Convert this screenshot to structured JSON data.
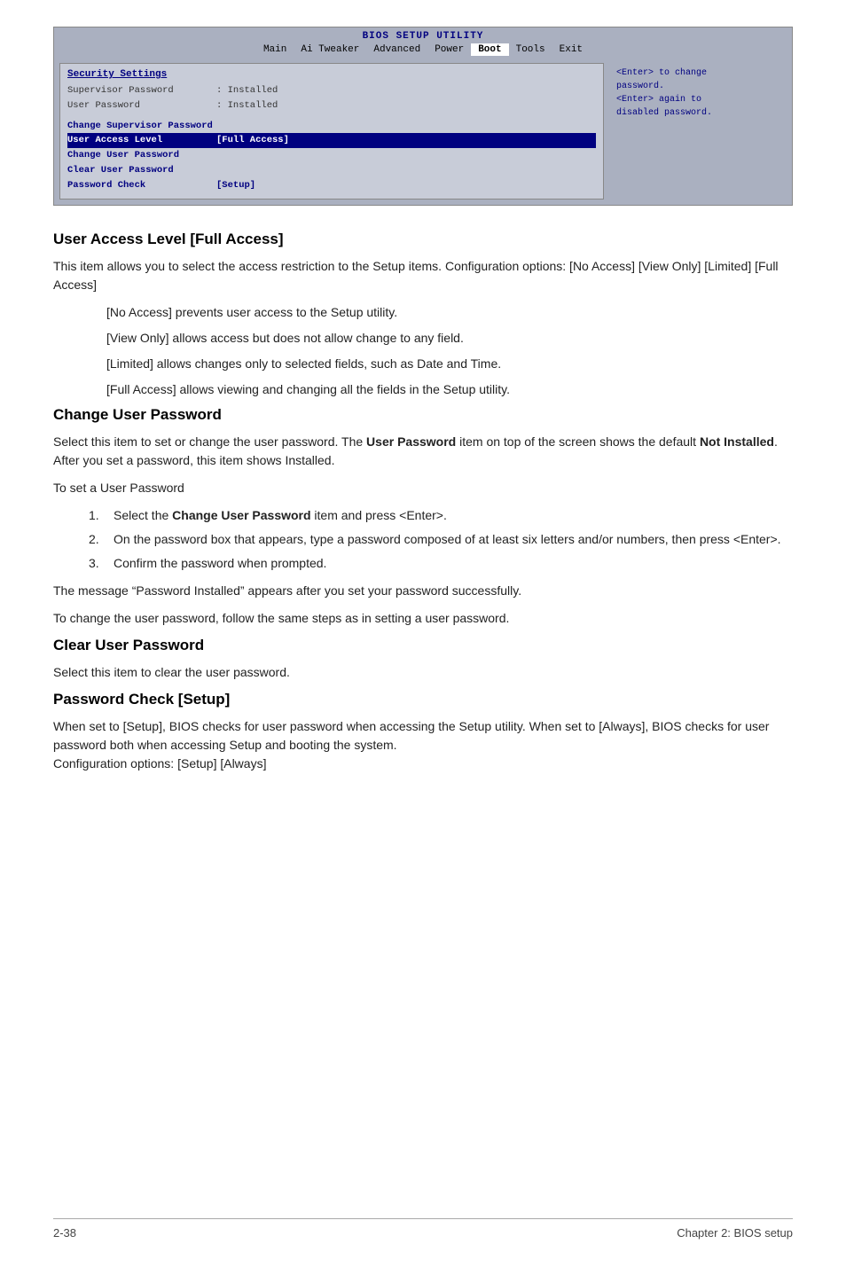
{
  "bios": {
    "title": "BIOS SETUP UTILITY",
    "tabs": [
      "Main",
      "Ai Tweaker",
      "Advanced",
      "Power",
      "Boot",
      "Tools",
      "Exit"
    ],
    "active_tab": "Boot",
    "left_panel": {
      "section_title": "Security Settings",
      "items": [
        {
          "label": "Supervisor Password",
          "value": ": Installed",
          "style": "dim"
        },
        {
          "label": "User Password",
          "value": ": Installed",
          "style": "dim"
        },
        {
          "label": "",
          "value": "",
          "style": "separator"
        },
        {
          "label": "Change Supervisor Password",
          "value": "",
          "style": "highlight"
        },
        {
          "label": "User Access Level",
          "value": "[Full Access]",
          "style": "highlight"
        },
        {
          "label": "Change User Password",
          "value": "",
          "style": "highlight"
        },
        {
          "label": "Clear User Password",
          "value": "",
          "style": "highlight"
        },
        {
          "label": "Password Check",
          "value": "[Setup]",
          "style": "highlight"
        }
      ]
    },
    "right_panel": {
      "text": "<Enter> to change password.\n<Enter> again to disabled password."
    }
  },
  "sections": [
    {
      "id": "user-access-level",
      "heading": "User Access Level [Full Access]",
      "paragraphs": [
        "This item allows you to select the access restriction to the Setup items. Configuration options: [No Access] [View Only] [Limited] [Full Access]"
      ],
      "indented": [
        "[No Access] prevents user access to the Setup utility.",
        "[View Only] allows access but does not allow change to any field.",
        "[Limited] allows changes only to selected fields, such as Date and Time.",
        "[Full Access] allows viewing and changing all the fields in the Setup utility."
      ]
    },
    {
      "id": "change-user-password",
      "heading": "Change User Password",
      "paragraphs": [
        "Select this item to set or change the user password. The **User Password** item on top of the screen shows the default **Not Installed**. After you set a password, this item shows Installed.",
        "To set a User Password"
      ],
      "numbered": [
        "Select the **Change User Password** item and press <Enter>.",
        "On the password box that appears, type a password composed of at least six letters and/or numbers, then press <Enter>.",
        "Confirm the password when prompted."
      ],
      "after_numbered": [
        "The message “Password Installed” appears after you set your password successfully.",
        "To change the user password, follow the same steps as in setting a user password."
      ]
    },
    {
      "id": "clear-user-password",
      "heading": "Clear User Password",
      "paragraphs": [
        "Select this item to clear the user password."
      ]
    },
    {
      "id": "password-check",
      "heading": "Password Check [Setup]",
      "paragraphs": [
        "When set to [Setup], BIOS checks for user password when accessing the Setup utility. When set to [Always], BIOS checks for user password both when accessing Setup and booting the system.",
        "Configuration options: [Setup] [Always]"
      ]
    }
  ],
  "footer": {
    "page_number": "2-38",
    "chapter": "Chapter 2: BIOS setup"
  }
}
